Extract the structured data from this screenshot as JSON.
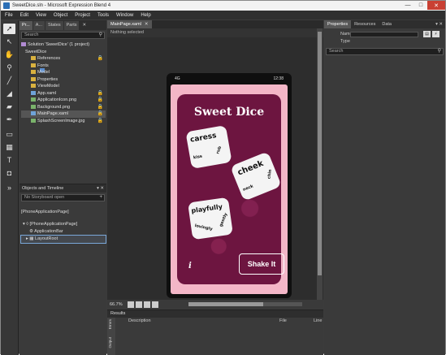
{
  "window": {
    "title": "SweetDice.sln - Microsoft Expression Blend 4",
    "minimize_glyph": "—",
    "maximize_glyph": "□",
    "close_glyph": "✕"
  },
  "menu": [
    "File",
    "Edit",
    "View",
    "Object",
    "Project",
    "Tools",
    "Window",
    "Help"
  ],
  "tools": [
    "selection-icon",
    "direct-selection-icon",
    "pan-icon",
    "zoom-icon",
    "eyedropper-icon",
    "paint-bucket-icon",
    "gradient-icon",
    "pen-icon",
    "rectangle-icon",
    "grid-icon",
    "textblock-icon",
    "layout-icon",
    "assets-icon"
  ],
  "project_panel": {
    "tabs": [
      "Pr...",
      "A...",
      "States",
      "Parts"
    ],
    "close_glyph": "✕",
    "search_placeholder": "Search",
    "tree": [
      {
        "label": "Solution 'SweetDice' (1 project)",
        "type": "sol",
        "indent": 0,
        "lock": ""
      },
      {
        "label": "SweetDice",
        "type": "proj",
        "indent": 1,
        "lock": ""
      },
      {
        "label": "References",
        "type": "folder",
        "indent": 2,
        "lock": "🔒"
      },
      {
        "label": "Fonts",
        "type": "folder",
        "indent": 2,
        "lock": ""
      },
      {
        "label": "Model",
        "type": "folder",
        "indent": 2,
        "lock": ""
      },
      {
        "label": "Properties",
        "type": "folder",
        "indent": 2,
        "lock": ""
      },
      {
        "label": "ViewModel",
        "type": "folder",
        "indent": 2,
        "lock": ""
      },
      {
        "label": "App.xaml",
        "type": "file",
        "indent": 2,
        "lock": "🔒"
      },
      {
        "label": "ApplicationIcon.png",
        "type": "img",
        "indent": 2,
        "lock": "🔒"
      },
      {
        "label": "Background.png",
        "type": "img",
        "indent": 2,
        "lock": "🔒"
      },
      {
        "label": "MainPage.xaml",
        "type": "file",
        "indent": 2,
        "lock": "🔒"
      },
      {
        "label": "SplashScreenImage.jpg",
        "type": "img",
        "indent": 2,
        "lock": "🔒"
      }
    ]
  },
  "objects_panel": {
    "title": "Objects and Timeline",
    "storyboard": "No Storyboard open",
    "rows": [
      "[PhoneApplicationPage]",
      "[PhoneApplicationPage]",
      "ApplicationBar",
      "LayoutRoot"
    ]
  },
  "document": {
    "tab": "MainPage.xaml",
    "breadcrumb": "Nothing selected",
    "zoom": "66.7%"
  },
  "phone": {
    "carrier": "4G",
    "clock": "12:38",
    "title": "Sweet Dice",
    "dice": [
      {
        "top": "caress",
        "left": "kiss",
        "right": "rub"
      },
      {
        "top": "cheek",
        "left": "neck",
        "right": "chin"
      },
      {
        "top": "playfully",
        "left": "lovingly",
        "right": "gently"
      }
    ],
    "info": "i",
    "shake_button": "Shake It"
  },
  "properties": {
    "tabs": [
      "Properties",
      "Resources",
      "Data"
    ],
    "panel_glyphs": "▾ ✕",
    "name_label": "Name",
    "type_label": "Type",
    "search_placeholder": "Search"
  },
  "results": {
    "title": "Results",
    "tabs": [
      "Errors",
      "Output"
    ],
    "columns": [
      "Description",
      "File",
      "Line"
    ]
  }
}
